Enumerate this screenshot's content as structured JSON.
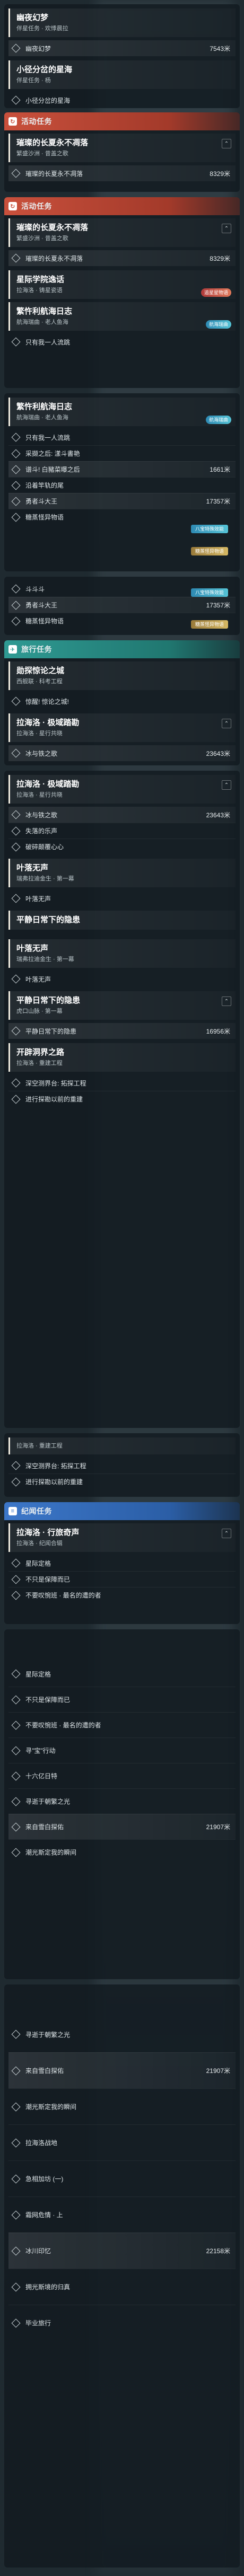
{
  "panels": [
    {
      "top": 0,
      "header": null,
      "quests": [
        {
          "title": "幽夜幻梦",
          "sub": "伴星任务 · 欢悸晨拉",
          "objectives": [
            {
              "text": "幽夜幻梦",
              "dist": "7543米",
              "active": true
            }
          ]
        },
        {
          "title": "小径分岔的星海",
          "sub": "伴星任务 · 杨",
          "objectives": [
            {
              "text": "小径分岔的星海",
              "dist": "",
              "active": false
            }
          ]
        }
      ]
    }
  ],
  "sections": {
    "s1": {
      "header": "活动任务",
      "quest_title": "璀璨的长夏永不凋落",
      "quest_sub": "繁盛沙洲 · 昔盖之歌",
      "obj": "璀璨的长夏永不凋落",
      "dist": "8329米"
    },
    "s2": {
      "header": "活动任务",
      "quest_title": "璀璨的长夏永不凋落",
      "quest_sub": "繁盛沙洲 · 昔盖之歌",
      "obj": "璀璨的长夏永不凋落",
      "dist": "8329米"
    },
    "s2b": {
      "quest_title": "星际学院逸话",
      "quest_sub": "拉海洛 · 铸星瓷语",
      "badge": "追星星物语"
    },
    "s2c": {
      "quest_title": "繁忤利航海日志",
      "quest_sub": "航海瑞曲 · 老人鱼海",
      "obj": "只有我一人流跳",
      "badge": "航海瑞曲"
    },
    "s3": {
      "quest_title": "繁忤利航海日志",
      "quest_sub": "航海瑞曲 · 老人鱼海",
      "badge": "航海瑞曲",
      "objs": [
        {
          "text": "只有我一人流跳",
          "dist": ""
        },
        {
          "text": "采撷之后: 漾斗書艳",
          "dist": ""
        },
        {
          "text": "谱斗! 白豬菜曝之后",
          "dist": "1661米"
        },
        {
          "text": "沿着竿轨的尾",
          "dist": ""
        },
        {
          "text": "勇者斗大王",
          "dist": "17357米"
        },
        {
          "text": "糖蒸怪异物语",
          "dist": ""
        }
      ],
      "tag1": "八宝特殊效能",
      "tag2": "糖蒸怪异物语"
    },
    "s4": {
      "objs": [
        {
          "text": "斗斗斗",
          "dist": ""
        },
        {
          "text": "勇者斗大王",
          "dist": "17357米"
        },
        {
          "text": "糖蒸怪异物语",
          "dist": ""
        }
      ],
      "tag1": "八宝特殊效能",
      "tag2": "糖蒸怪异物语"
    },
    "s5": {
      "header": "旅行任务",
      "q1_title": "勋探惊论之城",
      "q1_sub": "西舰联 · 科考工程",
      "q1_obj": "惊醒! 惊论之城!",
      "q2_title": "拉海洛 · 极域踏勘",
      "q2_sub": "拉海洛 · 星行共晓",
      "q2_obj": "冰与铁之歌",
      "q2_dist": "23643米"
    },
    "s6": {
      "q1_title": "拉海洛 · 极域踏勘",
      "q1_sub": "拉海洛 · 星行共晓",
      "q1_objs": [
        {
          "text": "冰与铁之歌",
          "dist": "23643米"
        },
        {
          "text": "失落的乐声",
          "dist": ""
        },
        {
          "text": "破碎颠覆心心",
          "dist": ""
        }
      ],
      "q2_title": "叶落无声",
      "q2_sub": "瑞弗拉迪金生 · 第一幕",
      "q2_obj": "叶落无声",
      "q3_title": "平静日常下的隐患",
      "q3_sub": "",
      "q4_title": "叶落无声",
      "q4_sub": "瑞弗拉迪金生 · 第一幕",
      "q4_obj": "叶落无声",
      "q5_title": "平静日常下的隐患",
      "q5_sub": "虎口山脉 · 第一幕",
      "q5_obj": "平静日常下的隐患",
      "q5_dist": "16956米",
      "q6_title": "开辟洞界之路",
      "q6_sub": "拉海洛 · 重建工程",
      "q6_objs": [
        {
          "text": "深空测界台: 拓探工程",
          "dist": ""
        },
        {
          "text": "进行探勘以前的重建",
          "dist": ""
        }
      ]
    },
    "s7": {
      "q1_sub": "拉海洛 · 重建工程",
      "q1_objs": [
        {
          "text": "深空测界台: 拓探工程",
          "dist": ""
        },
        {
          "text": "进行探勘以前的重建",
          "dist": ""
        }
      ]
    },
    "s8": {
      "header": "纪闻任务",
      "q1_title": "拉海洛 · 行旅奇声",
      "q1_sub": "拉海洛 · 纪闻合辑",
      "q1_objs": [
        {
          "text": "星际定格",
          "dist": ""
        },
        {
          "text": "不只是保障而已",
          "dist": ""
        },
        {
          "text": "不要叹惋班 · 最名的遭的者",
          "dist": ""
        }
      ]
    },
    "s9": {
      "objs": [
        {
          "text": "星际定格",
          "dist": ""
        },
        {
          "text": "不只是保障而已",
          "dist": ""
        },
        {
          "text": "不要叹惋班 · 最名的遭的者",
          "dist": ""
        },
        {
          "text": "寻\"宝\"行动",
          "dist": ""
        },
        {
          "text": "十六亿日特",
          "dist": ""
        },
        {
          "text": "寻逝于朝繁之光",
          "dist": ""
        },
        {
          "text": "来自雪白探佑",
          "dist": "21907米"
        },
        {
          "text": "潮光斯定我的瞬间",
          "dist": ""
        }
      ]
    },
    "s10": {
      "objs": [
        {
          "text": "寻逝于朝繁之光",
          "dist": ""
        },
        {
          "text": "来自雪白探佑",
          "dist": "21907米"
        },
        {
          "text": "潮光斯定我的瞬间",
          "dist": ""
        },
        {
          "text": "拉海洛战地",
          "dist": ""
        },
        {
          "text": "急相加坊 (一)",
          "dist": ""
        },
        {
          "text": "霜网危情 · 上",
          "dist": ""
        },
        {
          "text": "冰川印忆",
          "dist": "22158米"
        },
        {
          "text": "拥光斯境的归真",
          "dist": ""
        },
        {
          "text": "毕业旅行",
          "dist": ""
        }
      ]
    }
  }
}
